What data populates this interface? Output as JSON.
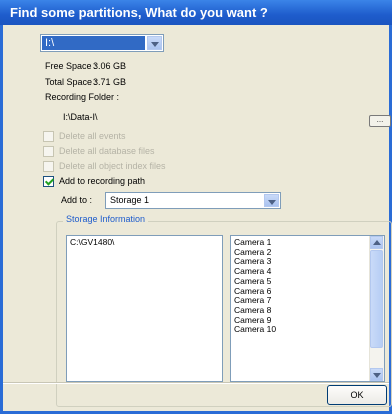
{
  "window": {
    "title": "Find some partitions, What do you want ?"
  },
  "drive": {
    "selected": "I:\\"
  },
  "info": {
    "free_space_label": "Free Space :",
    "free_space_value": "3.06 GB",
    "total_space_label": "Total Space :",
    "total_space_value": "3.71 GB",
    "recording_folder_label": "Recording Folder :",
    "recording_folder_value": "I:\\Data-I\\",
    "browse_label": "..."
  },
  "options": [
    {
      "label": "Delete all events",
      "checked": false,
      "enabled": false
    },
    {
      "label": "Delete all database files",
      "checked": false,
      "enabled": false
    },
    {
      "label": "Delete all object index files",
      "checked": false,
      "enabled": false
    },
    {
      "label": "Add to recording path",
      "checked": true,
      "enabled": true
    }
  ],
  "add_to": {
    "label": "Add to :",
    "selected": "Storage 1"
  },
  "storage_info": {
    "title": "Storage Information",
    "paths": [
      "C:\\GV1480\\"
    ],
    "cameras": [
      "Camera 1",
      "Camera 2",
      "Camera 3",
      "Camera 4",
      "Camera 5",
      "Camera 6",
      "Camera 7",
      "Camera 8",
      "Camera 9",
      "Camera 10"
    ]
  },
  "ok_label": "OK",
  "icons": {
    "dropdown": "chevron-down-icon",
    "check": "checkmark-icon",
    "scroll_up": "arrow-up-icon",
    "scroll_down": "arrow-down-icon"
  },
  "colors": {
    "titlebar": "#1e5ccc",
    "dialog": "#ece9d8",
    "selection": "#316ac5"
  }
}
